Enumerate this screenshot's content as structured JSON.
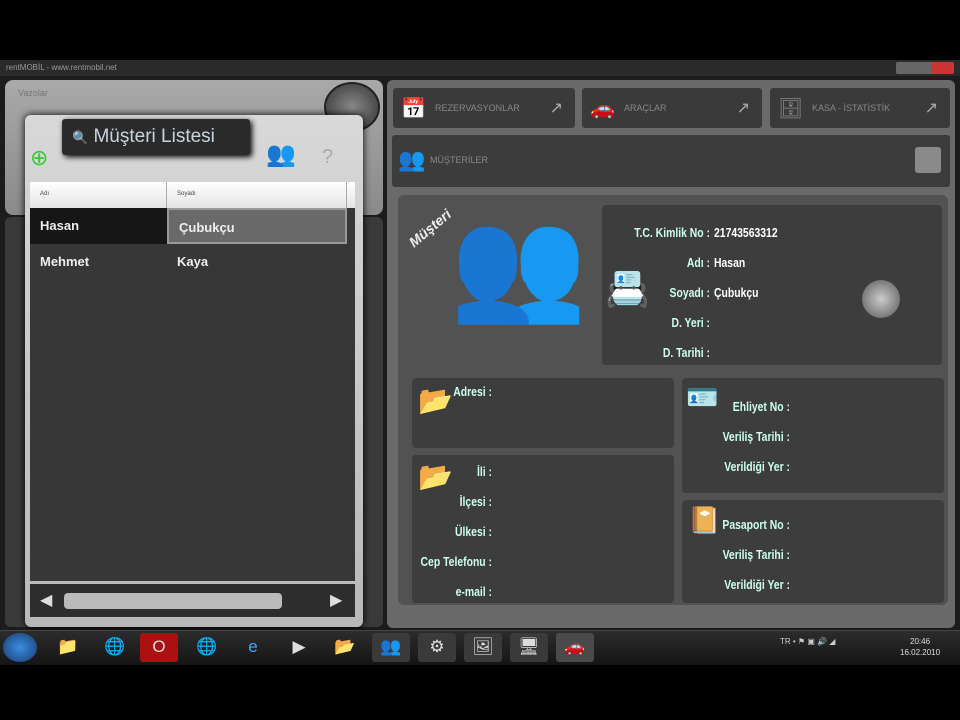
{
  "window": {
    "title": "rentMOBİL - www.rentmobil.net"
  },
  "left": {
    "favorites_label": "Vazolar",
    "popup_title": "Müşteri Listesi",
    "columns": [
      "Adı",
      "Soyadı"
    ],
    "rows": [
      {
        "ad": "Hasan",
        "soyad": "Çubukçu"
      },
      {
        "ad": "Mehmet",
        "soyad": "Kaya"
      }
    ]
  },
  "tabs": [
    {
      "label": "REZERVASYONLAR",
      "icon": "calendar-icon"
    },
    {
      "label": "ARAÇLAR",
      "icon": "car-icon"
    },
    {
      "label": "KASA - İSTATİSTİK",
      "icon": "safe-icon"
    }
  ],
  "musteriler": {
    "label": "MÜŞTERİLER"
  },
  "detail": {
    "badge": "Müşteri",
    "fields": [
      {
        "label": "T.C. Kimlik No :",
        "value": "21743563312"
      },
      {
        "label": "Adı :",
        "value": "Hasan"
      },
      {
        "label": "Soyadı :",
        "value": "Çubukçu"
      },
      {
        "label": "D. Yeri :",
        "value": ""
      },
      {
        "label": "D. Tarihi :",
        "value": ""
      }
    ],
    "address": {
      "label": "Adresi :"
    },
    "contact": [
      "İli :",
      "İlçesi :",
      "Ülkesi :",
      "Cep Telefonu :",
      "e-mail :"
    ],
    "license": [
      "Ehliyet No :",
      "Veriliş Tarihi :",
      "Verildiği Yer :"
    ],
    "passport": [
      "Pasaport No :",
      "Veriliş Tarihi :",
      "Verildiği Yer :"
    ]
  },
  "taskbar": {
    "lang": "TR",
    "time": "20:46",
    "date": "16.02.2010"
  }
}
